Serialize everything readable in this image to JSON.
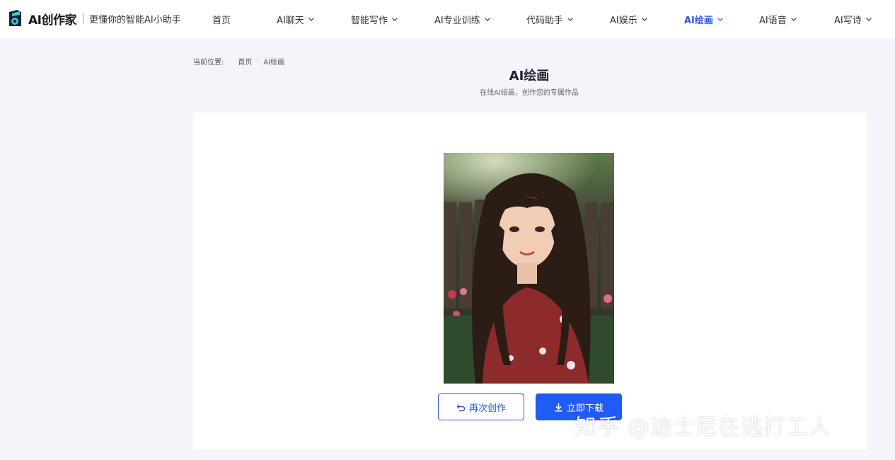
{
  "header": {
    "brand_name": "AI创作家",
    "slogan": "更懂你的智能AI小助手",
    "nav": [
      {
        "label": "首页",
        "has_menu": false,
        "active": false
      },
      {
        "label": "AI聊天",
        "has_menu": true,
        "active": false
      },
      {
        "label": "智能写作",
        "has_menu": true,
        "active": false
      },
      {
        "label": "AI专业训练",
        "has_menu": true,
        "active": false
      },
      {
        "label": "代码助手",
        "has_menu": true,
        "active": false
      },
      {
        "label": "AI娱乐",
        "has_menu": true,
        "active": false
      },
      {
        "label": "AI绘画",
        "has_menu": true,
        "active": true
      },
      {
        "label": "AI语音",
        "has_menu": true,
        "active": false
      },
      {
        "label": "AI写诗",
        "has_menu": true,
        "active": false
      }
    ]
  },
  "breadcrumb": {
    "label": "当前位置:",
    "items": [
      "首页",
      "AI绘画"
    ]
  },
  "page": {
    "title": "AI绘画",
    "subtitle": "在线AI绘画，创作您的专属作品"
  },
  "actions": {
    "recreate_label": "再次创作",
    "download_label": "立即下载"
  },
  "watermark": "知乎 @迪士尼在逃打工人",
  "colors": {
    "accent": "#2b58d6",
    "primary_button": "#1f5cf5",
    "page_bg": "#f4f5fb"
  }
}
